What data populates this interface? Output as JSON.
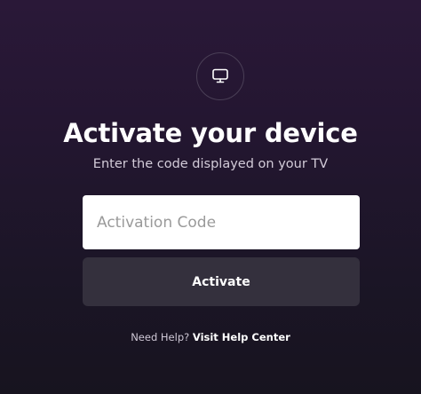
{
  "header": {
    "icon": "monitor-icon",
    "title": "Activate your device",
    "subtitle": "Enter the code displayed on your TV"
  },
  "form": {
    "code_value": "",
    "code_placeholder": "Activation Code",
    "activate_label": "Activate"
  },
  "help": {
    "prompt": "Need Help?",
    "link_label": "Visit Help Center"
  },
  "colors": {
    "background_top": "#2a1838",
    "background_bottom": "#17141f",
    "button_bg": "#34303d",
    "input_bg": "#ffffff"
  }
}
